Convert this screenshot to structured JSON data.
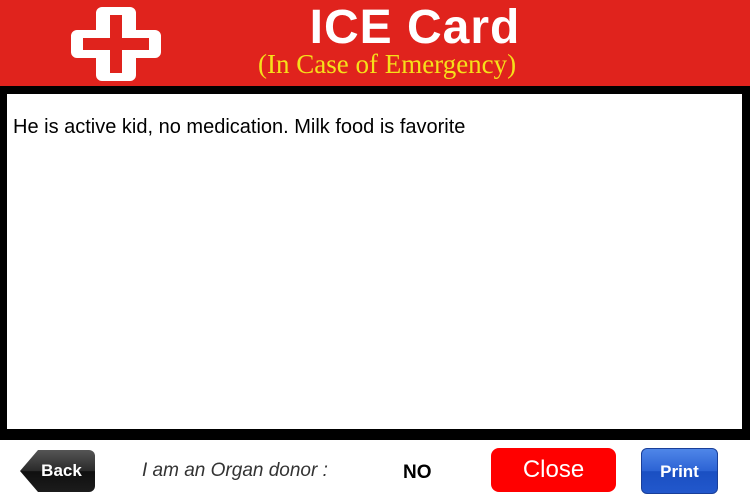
{
  "header": {
    "title": "ICE Card",
    "subtitle": "(In Case of Emergency)",
    "icon": "medical-cross-icon",
    "background_color": "#e0231d",
    "subtitle_color": "#f5e01a"
  },
  "notes": {
    "text": "He is active kid, no medication. Milk food is favorite"
  },
  "footer": {
    "back_label": "Back",
    "donor_label": "I am an Organ donor :",
    "donor_value": "NO",
    "close_label": "Close",
    "print_label": "Print",
    "close_color": "#ff0000",
    "print_color": "#2c63d4"
  }
}
